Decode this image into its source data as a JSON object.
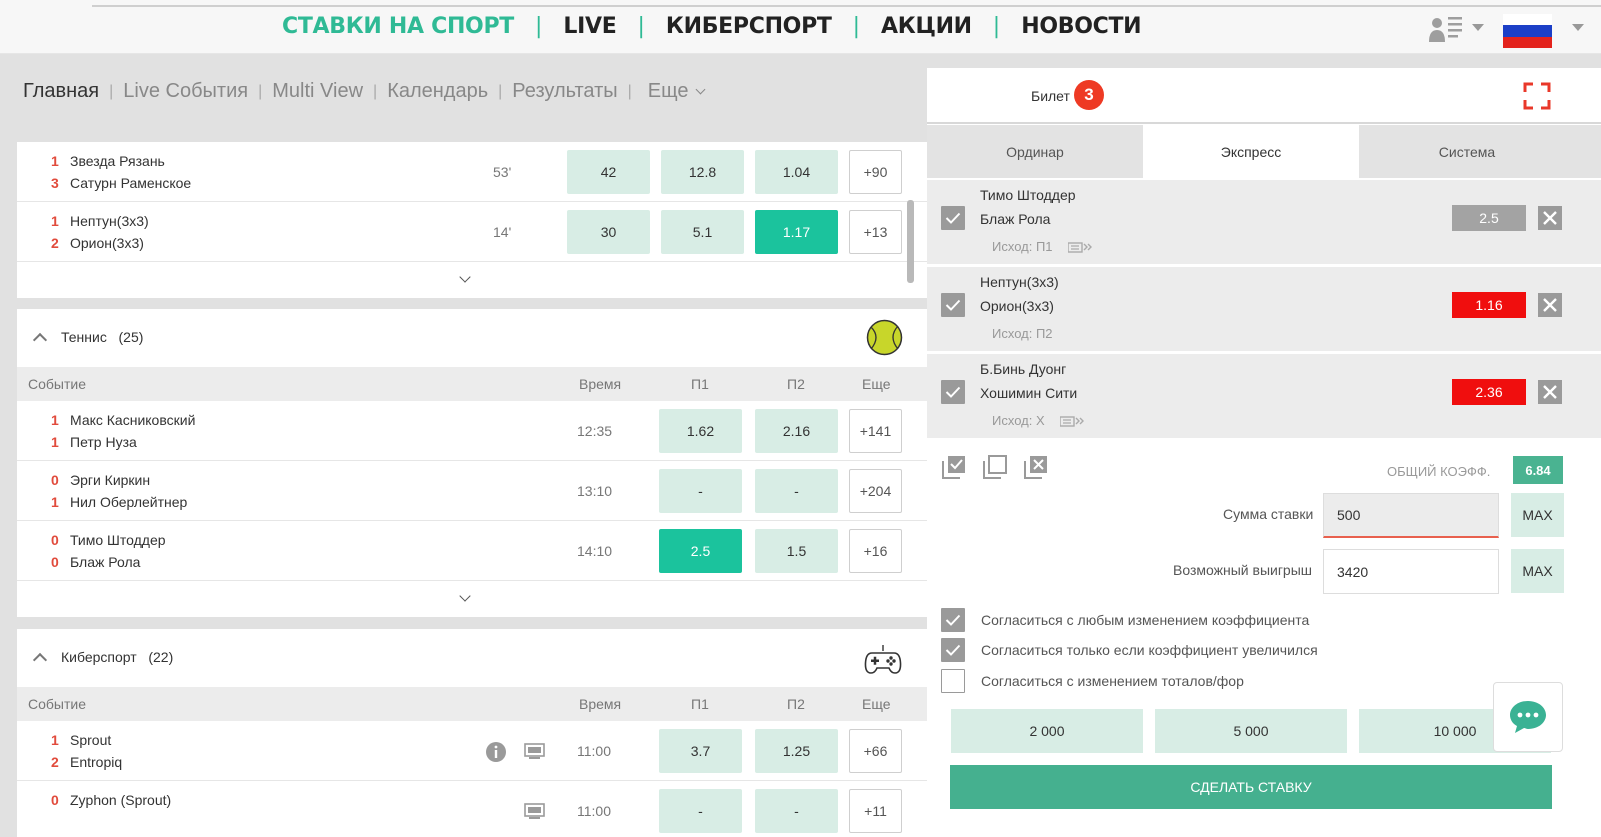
{
  "topnav": {
    "items": [
      "СТАВКИ НА СПОРТ",
      "LIVE",
      "КИБЕРСПОРТ",
      "АКЦИИ",
      "НОВОСТИ"
    ],
    "separator": "|",
    "icons": [
      "user-list-icon",
      "russia-flag-icon"
    ]
  },
  "subnav": {
    "items": [
      "Главная",
      "Live События",
      "Multi View",
      "Календарь",
      "Результаты"
    ],
    "separator": "|",
    "more_label": "Еще"
  },
  "live_matches": [
    {
      "n1": "1",
      "team1": "Звезда Рязань",
      "n2": "3",
      "team2": "Сатурн Раменское",
      "time": "53'",
      "odds": [
        "42",
        "12.8",
        "1.04"
      ],
      "more": "+90",
      "selected": -1
    },
    {
      "n1": "1",
      "team1": "Нептун(3х3)",
      "n2": "2",
      "team2": "Орион(3х3)",
      "time": "14'",
      "odds": [
        "30",
        "5.1",
        "1.17"
      ],
      "more": "+13",
      "selected": 2
    }
  ],
  "tennis": {
    "title": "Теннис",
    "count": "(25)",
    "columns": {
      "event": "Событие",
      "time": "Время",
      "p1": "П1",
      "p2": "П2",
      "more": "Еще"
    },
    "matches": [
      {
        "n1": "1",
        "team1": "Макс Касниковский",
        "n2": "1",
        "team2": "Петр Нуза",
        "time": "12:35",
        "odds": [
          "1.62",
          "2.16"
        ],
        "more": "+141",
        "selected": -1
      },
      {
        "n1": "0",
        "team1": "Эрги Киркин",
        "n2": "1",
        "team2": "Нил Оберлейтнер",
        "time": "13:10",
        "odds": [
          "-",
          "-"
        ],
        "more": "+204",
        "selected": -1
      },
      {
        "n1": "0",
        "team1": "Тимо Штоддер",
        "n2": "0",
        "team2": "Блаж Рола",
        "time": "14:10",
        "odds": [
          "2.5",
          "1.5"
        ],
        "more": "+16",
        "selected": 0
      }
    ]
  },
  "esports": {
    "title": "Киберспорт",
    "count": "(22)",
    "columns": {
      "event": "Событие",
      "time": "Время",
      "p1": "П1",
      "p2": "П2",
      "more": "Еще"
    },
    "matches": [
      {
        "n1": "1",
        "team1": "Sprout",
        "n2": "2",
        "team2": "Entropiq",
        "time": "11:00",
        "odds": [
          "3.7",
          "1.25"
        ],
        "more": "+66"
      },
      {
        "n1": "0",
        "team1": "Zyphon (Sprout)",
        "n2": "",
        "team2": "",
        "time": "11:00",
        "odds": [
          "-",
          "-"
        ],
        "more": "+11"
      }
    ]
  },
  "betslip": {
    "title": "Билет",
    "badge": "3",
    "tabs": [
      "Ординар",
      "Экспресс",
      "Система"
    ],
    "active_tab": 1,
    "items": [
      {
        "team1": "Тимо Штоддер",
        "team2": "Блаж Рола",
        "outcome": "Исход: П1",
        "odds": "2.5",
        "odds_color": "#a3a3a3",
        "checked": true
      },
      {
        "team1": "Нептун(3х3)",
        "team2": "Орион(3х3)",
        "outcome": "Исход: П2",
        "odds": "1.16",
        "odds_color": "#f00e0e",
        "checked": true
      },
      {
        "team1": "Б.Бинь Дуонг",
        "team2": "Хошимин Сити",
        "outcome": "Исход: Х",
        "odds": "2.36",
        "odds_color": "#f00e0e",
        "checked": true
      }
    ],
    "total_label": "ОБЩИЙ КОЭФФ.",
    "total_value": "6.84",
    "stake_label": "Сумма ставки",
    "stake_value": "500",
    "win_label": "Возможный выигрыш",
    "win_value": "3420",
    "max_label": "MAX",
    "agreements": [
      {
        "text": "Согласиться с любым изменением коэффициента",
        "checked": true
      },
      {
        "text": "Согласиться только если коэффициент увеличился",
        "checked": true
      },
      {
        "text": "Согласиться с изменением тоталов/фор",
        "checked": false
      }
    ],
    "quick_amounts": [
      "2 000",
      "5 000",
      "10 000"
    ],
    "submit_label": "СДЕЛАТЬ СТАВКУ"
  }
}
